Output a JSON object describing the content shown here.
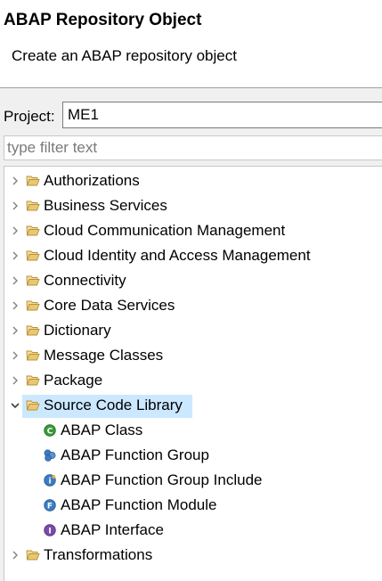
{
  "dialog": {
    "title": "ABAP Repository Object",
    "subtitle": "Create an ABAP repository object"
  },
  "project": {
    "label": "Project:",
    "value": "ME1"
  },
  "filter": {
    "placeholder": "type filter text"
  },
  "tree": {
    "folders": [
      {
        "label": "Authorizations"
      },
      {
        "label": "Business Services"
      },
      {
        "label": "Cloud Communication Management"
      },
      {
        "label": "Cloud Identity and Access Management"
      },
      {
        "label": "Connectivity"
      },
      {
        "label": "Core Data Services"
      },
      {
        "label": "Dictionary"
      },
      {
        "label": "Message Classes"
      },
      {
        "label": "Package"
      },
      {
        "label": "Source Code Library"
      },
      {
        "label": "Transformations"
      }
    ],
    "children": [
      {
        "label": "ABAP Class",
        "icon": "abap-class-icon",
        "color": "#3a9a3a"
      },
      {
        "label": "ABAP Function Group",
        "icon": "abap-function-group-icon",
        "color": "#3b7cc4"
      },
      {
        "label": "ABAP Function Group Include",
        "icon": "abap-function-group-include-icon",
        "color": "#3b7cc4"
      },
      {
        "label": "ABAP Function Module",
        "icon": "abap-function-module-icon",
        "color": "#3b7cc4"
      },
      {
        "label": "ABAP Interface",
        "icon": "abap-interface-icon",
        "color": "#7a4aa8"
      }
    ]
  },
  "colors": {
    "selection": "#cce8ff",
    "folder": "#e8c872",
    "dialog_bg": "#f0f0f0"
  }
}
